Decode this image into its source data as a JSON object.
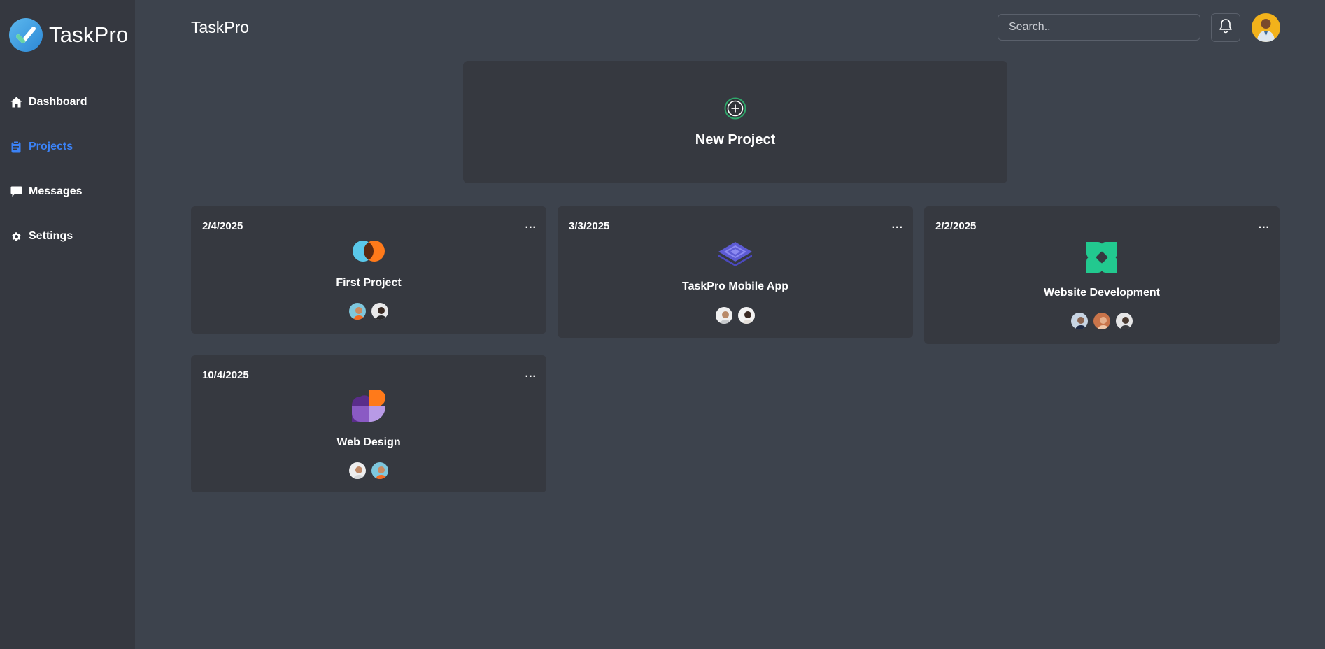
{
  "app": {
    "name": "TaskPro"
  },
  "sidebar": {
    "items": [
      {
        "label": "Dashboard",
        "icon": "home-icon"
      },
      {
        "label": "Projects",
        "icon": "clipboard-icon",
        "active": true
      },
      {
        "label": "Messages",
        "icon": "chat-icon"
      },
      {
        "label": "Settings",
        "icon": "gear-icon"
      }
    ]
  },
  "header": {
    "title": "TaskPro",
    "search_placeholder": "Search.."
  },
  "new_project": {
    "label": "New Project"
  },
  "projects": [
    {
      "date": "2/4/2025",
      "name": "First Project",
      "more": "...",
      "icon": "overlapping-circles-icon",
      "members": 2
    },
    {
      "date": "3/3/2025",
      "name": "TaskPro Mobile App",
      "more": "...",
      "icon": "stacked-layers-icon",
      "members": 2
    },
    {
      "date": "2/2/2025",
      "name": "Website Development",
      "more": "...",
      "icon": "clover-icon",
      "members": 3
    },
    {
      "date": "10/4/2025",
      "name": "Web Design",
      "more": "...",
      "icon": "pie-blob-icon",
      "members": 2
    }
  ],
  "colors": {
    "background": "#3d434d",
    "sidebar": "#353840",
    "card": "#363940",
    "accent": "#3b82f6",
    "avatar_bg": "#f2b21b"
  }
}
